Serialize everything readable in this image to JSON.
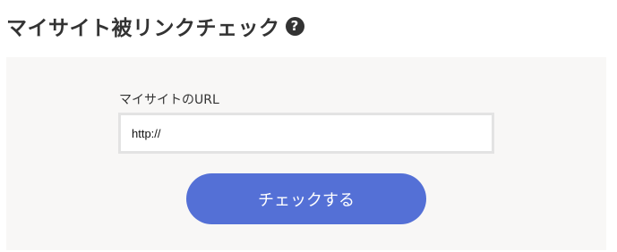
{
  "header": {
    "title": "マイサイト被リンクチェック",
    "help_icon_glyph": "?",
    "help_icon": "question-circle-icon"
  },
  "form": {
    "label": "マイサイトのURL",
    "url_value": "http://",
    "submit_label": "チェックする"
  },
  "colors": {
    "button": "#5470d6",
    "panel_background": "#f8f7f6",
    "title_text": "#333333"
  }
}
